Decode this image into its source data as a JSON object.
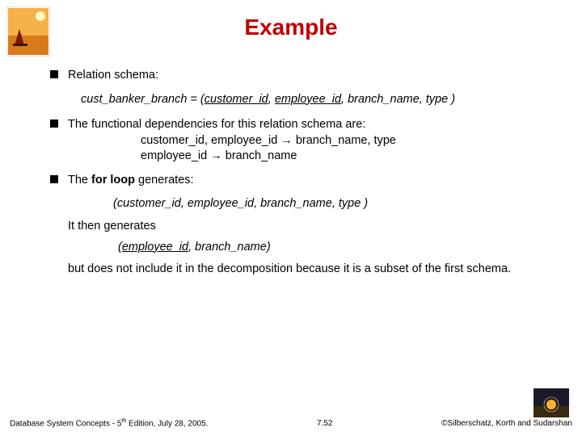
{
  "title": "Example",
  "b1": {
    "label": "Relation schema:"
  },
  "schema": {
    "name": "cust_banker_branch",
    "eq": " = (",
    "attr1": "customer_id",
    "c1": ", ",
    "attr2": "employee_id",
    "c2": ", ",
    "attr3": "branch_name, type",
    "close": " )"
  },
  "b2": {
    "label": "The functional dependencies for this relation schema are:",
    "fd1_lhs": "customer_id, employee_id ",
    "arrow": "→",
    "fd1_rhs": " branch_name, type",
    "fd2_lhs": "employee_id ",
    "fd2_rhs": " branch_name"
  },
  "b3": {
    "prefix": "The ",
    "forloop": "for loop",
    "suffix": " generates:"
  },
  "gen1": "(customer_id, employee_id, branch_name, type )",
  "then_gen": "It then generates",
  "gen2": {
    "open": "(",
    "a1": "employee_id",
    "c": ", ",
    "a2": "branch_name",
    "close": ")"
  },
  "para": "but does not include it in the decomposition because it is a subset of the first schema.",
  "footer": {
    "left_a": "Database System Concepts - 5",
    "left_sup": "th",
    "left_b": " Edition, July 28,  2005.",
    "center": "7.52",
    "right": "©Silberschatz, Korth and Sudarshan"
  }
}
